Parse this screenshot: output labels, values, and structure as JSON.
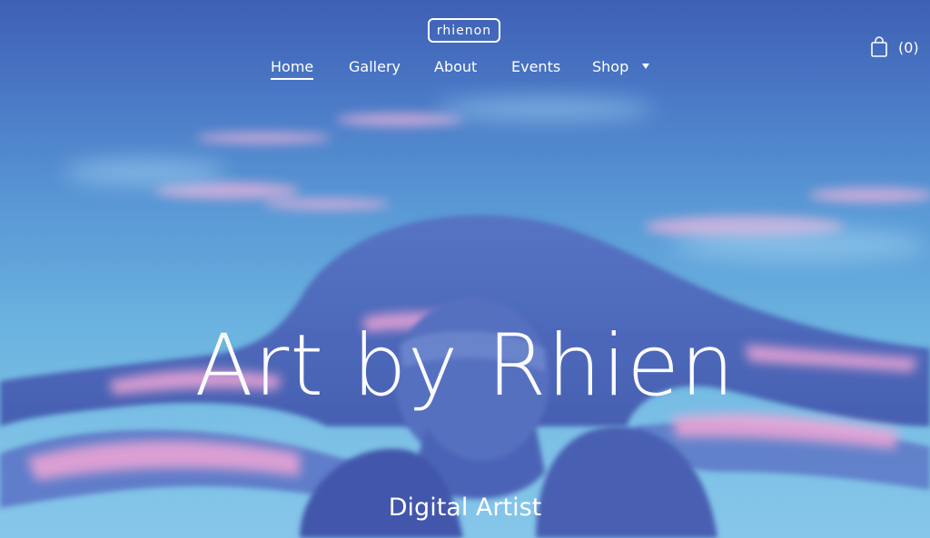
{
  "header": {
    "logo_text": "rhienon",
    "nav": [
      {
        "label": "Home",
        "active": true
      },
      {
        "label": "Gallery",
        "active": false
      },
      {
        "label": "About",
        "active": false
      },
      {
        "label": "Events",
        "active": false
      },
      {
        "label": "Shop",
        "active": false,
        "has_dropdown": true
      }
    ],
    "cart": {
      "icon": "shopping-bag-icon",
      "count_label": "(0)"
    }
  },
  "hero": {
    "title": "Art by Rhien",
    "subtitle": "Digital Artist"
  },
  "colors": {
    "sky_top": "#3f5fb4",
    "sky_bottom": "#86c6ea",
    "cloud_pink": "#e8a8d8",
    "figure_blue": "#4a62b6",
    "text": "#ffffff"
  }
}
